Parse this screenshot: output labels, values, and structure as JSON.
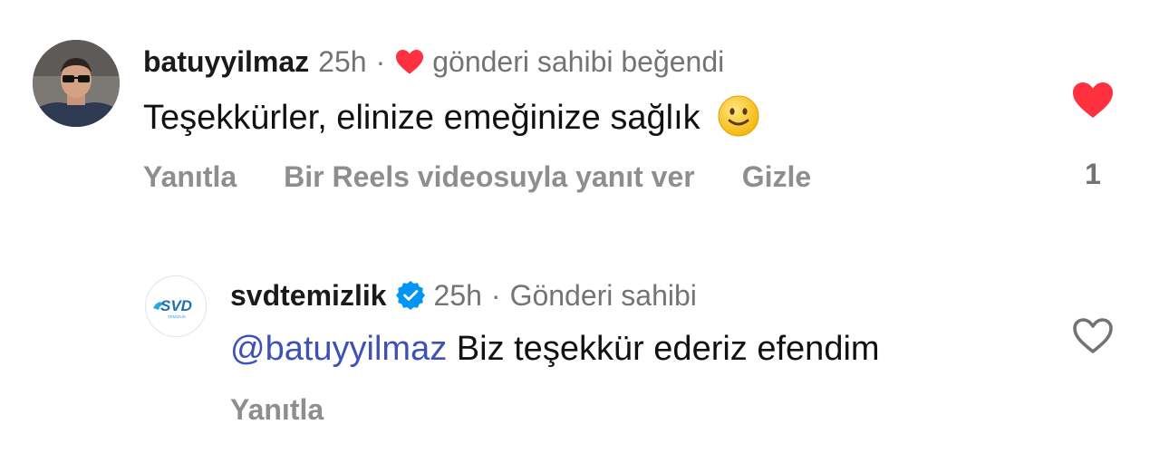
{
  "comment": {
    "username": "batuyyilmaz",
    "time": "25h",
    "separator": "·",
    "liked_by_owner": "gönderi sahibi beğendi",
    "text": "Teşekkürler, elinize emeğinize sağlık",
    "emoji": "slightly-smiling-face",
    "actions": {
      "reply": "Yanıtla",
      "reels_reply": "Bir Reels videosuyla yanıt ver",
      "hide": "Gizle"
    },
    "liked": true,
    "like_count": "1"
  },
  "reply": {
    "username": "svdtemizlik",
    "verified": true,
    "time": "25h",
    "separator": "·",
    "owner_label": "Gönderi sahibi",
    "mention": "@batuyyilmaz",
    "text": "Biz teşekkür ederiz efendim",
    "actions": {
      "reply": "Yanıtla"
    },
    "liked": false,
    "avatar_logo_text": "SVD",
    "avatar_logo_subtext": "TEMİZLİK"
  },
  "colors": {
    "like_red": "#ff3040",
    "muted_text": "#737373",
    "action_text": "#8e8e8e",
    "mention_blue": "#3f51b5",
    "verified_blue": "#0095f6"
  },
  "icons": {
    "owner_liked": "heart-filled-icon",
    "like_active": "heart-filled-icon",
    "like_inactive": "heart-outline-icon",
    "verified": "verified-badge-icon"
  }
}
